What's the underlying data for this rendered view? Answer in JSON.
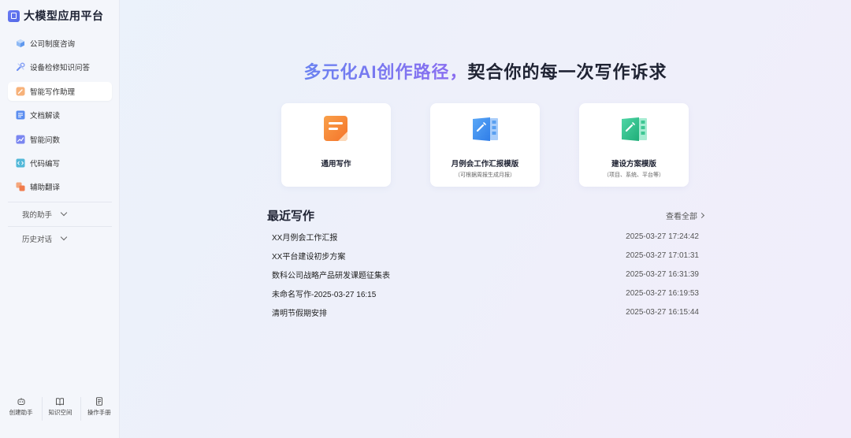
{
  "app": {
    "title": "大模型应用平台"
  },
  "sidebar": {
    "items": [
      {
        "label": "公司制度咨询",
        "icon": "box-icon",
        "color": "#6fa6f2",
        "active": false
      },
      {
        "label": "设备检修知识问答",
        "icon": "wrench-icon",
        "color": "#6d8ff3",
        "active": false
      },
      {
        "label": "智能写作助理",
        "icon": "pen-icon",
        "color": "#f5a76b",
        "active": true
      },
      {
        "label": "文档解读",
        "icon": "document-icon",
        "color": "#5b8ef0",
        "active": false
      },
      {
        "label": "智能问数",
        "icon": "chart-icon",
        "color": "#7a86f0",
        "active": false
      },
      {
        "label": "代码编写",
        "icon": "code-icon",
        "color": "#52b8d8",
        "active": false
      },
      {
        "label": "辅助翻译",
        "icon": "translate-icon",
        "color": "#f08a5b",
        "active": false
      }
    ],
    "groups": [
      {
        "label": "我的助手"
      },
      {
        "label": "历史对话"
      }
    ],
    "footer": [
      {
        "label": "创建助手",
        "icon": "robot-icon"
      },
      {
        "label": "知识空间",
        "icon": "book-icon"
      },
      {
        "label": "操作手册",
        "icon": "manual-icon"
      }
    ]
  },
  "main": {
    "headline_highlight": "多元化AI创作路径，",
    "headline_rest": "契合你的每一次写作诉求",
    "cards": [
      {
        "title": "通用写作",
        "subtitle": "",
        "icon": "note-icon",
        "color": "#f7882f"
      },
      {
        "title": "月例会工作汇报模版",
        "subtitle": "（可根据周报生成月报）",
        "icon": "film-edit-icon",
        "color": "#3f8ff0"
      },
      {
        "title": "建设方案模版",
        "subtitle": "（项目、系统、平台等）",
        "icon": "film-edit-icon",
        "color": "#27c08e"
      }
    ],
    "recent": {
      "title": "最近写作",
      "view_all": "查看全部",
      "items": [
        {
          "title": "XX月例会工作汇报",
          "time": "2025-03-27 17:24:42"
        },
        {
          "title": "XX平台建设初步方案",
          "time": "2025-03-27 17:01:31"
        },
        {
          "title": "数科公司战略产品研发课题征集表",
          "time": "2025-03-27 16:31:39"
        },
        {
          "title": "未命名写作-2025-03-27 16:15",
          "time": "2025-03-27 16:19:53"
        },
        {
          "title": "清明节假期安排",
          "time": "2025-03-27 16:15:44"
        }
      ]
    }
  }
}
